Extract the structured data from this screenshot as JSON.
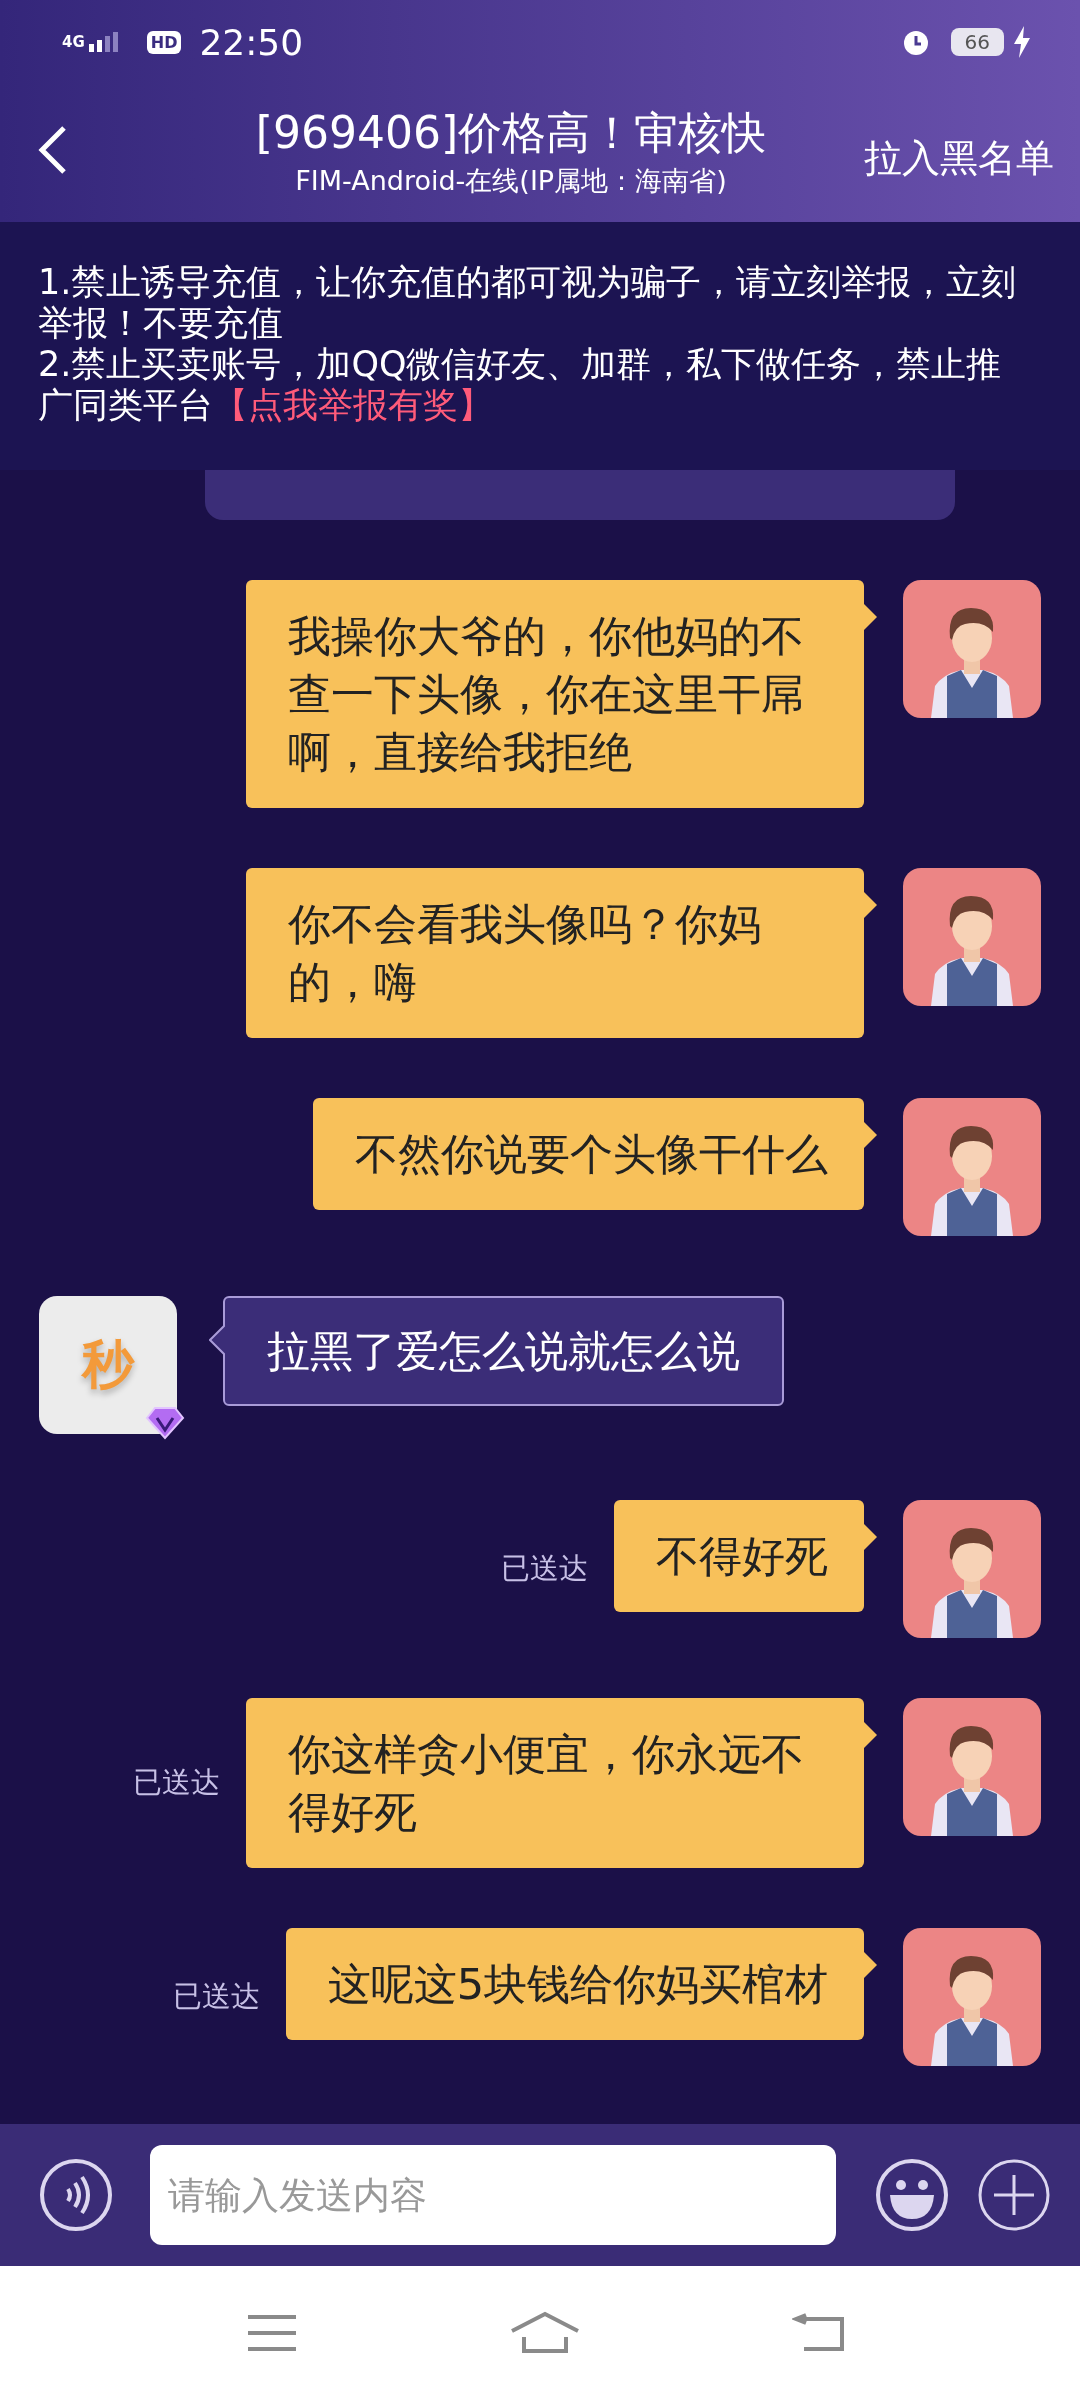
{
  "status_bar": {
    "network": "4G",
    "hd": "HD",
    "time": "22:50",
    "battery": "66"
  },
  "header": {
    "title": "[969406]价格高！审核快",
    "subtitle": "FIM-Android-在线(IP属地：海南省)",
    "action": "拉入黑名单"
  },
  "notice": {
    "lines": [
      "1.禁止诱导充值，让你充值的都可视为骗子，请立刻举报，立刻举报！不要充值",
      "2.禁止买卖账号，加QQ微信好友、加群，私下做任务，禁止推广同类平台"
    ],
    "link": "【点我举报有奖】"
  },
  "messages": [
    {
      "kind": "partial"
    },
    {
      "kind": "outgoing",
      "text": "我操你大爷的，你他妈的不查一下头像，你在这里干屌啊，直接给我拒绝"
    },
    {
      "kind": "outgoing",
      "text": "你不会看我头像吗？你妈的，嗨"
    },
    {
      "kind": "outgoing",
      "text": "不然你说要个头像干什么"
    },
    {
      "kind": "incoming",
      "avatar_text": "秒",
      "text": "拉黑了爱怎么说就怎么说"
    },
    {
      "kind": "outgoing",
      "status": "已送达",
      "text": "不得好死"
    },
    {
      "kind": "outgoing",
      "status": "已送达",
      "text": "你这样贪小便宜，你永远不得好死"
    },
    {
      "kind": "outgoing",
      "status": "已送达",
      "text": "这呢这5块钱给你妈买棺材"
    }
  ],
  "composer": {
    "placeholder": "请输入发送内容"
  }
}
